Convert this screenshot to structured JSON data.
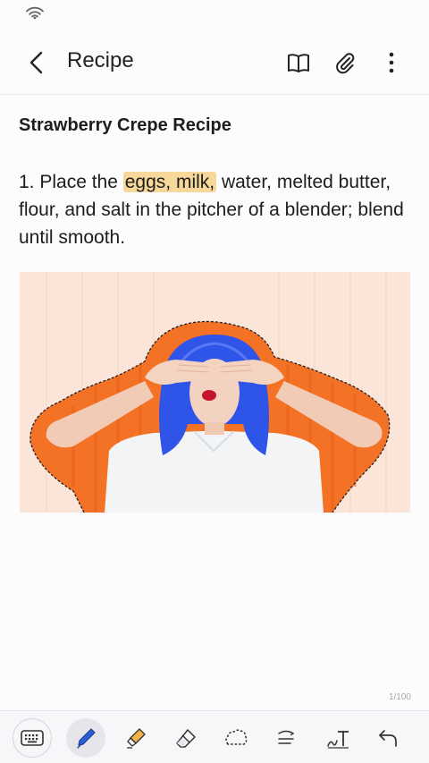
{
  "status_bar": {
    "wifi_icon": "wifi-icon"
  },
  "app_bar": {
    "title": "Recipe",
    "icons": [
      "back-arrow-icon",
      "book-icon",
      "paperclip-icon",
      "more-vertical-icon"
    ]
  },
  "note": {
    "title": "Strawberry Crepe Recipe",
    "step_prefix": "1. Place the ",
    "step_highlight": "eggs, milk,",
    "step_suffix": " water, melted butter, flour, and salt in the pitcher of a blender; blend until smooth.",
    "highlight_color": "#f8d79a"
  },
  "page_counter": "1/100",
  "toolbar": {
    "tools": [
      "keyboard",
      "pen",
      "highlighter",
      "eraser",
      "lasso",
      "straighten",
      "text",
      "undo"
    ],
    "active_tool": "pen",
    "pen_color": "#2f5fd6",
    "highlighter_color": "#f3b24a"
  },
  "colors": {
    "image_background": "#fbe4d8",
    "orange_wall": "#f47225",
    "hair": "#2f55e8"
  }
}
